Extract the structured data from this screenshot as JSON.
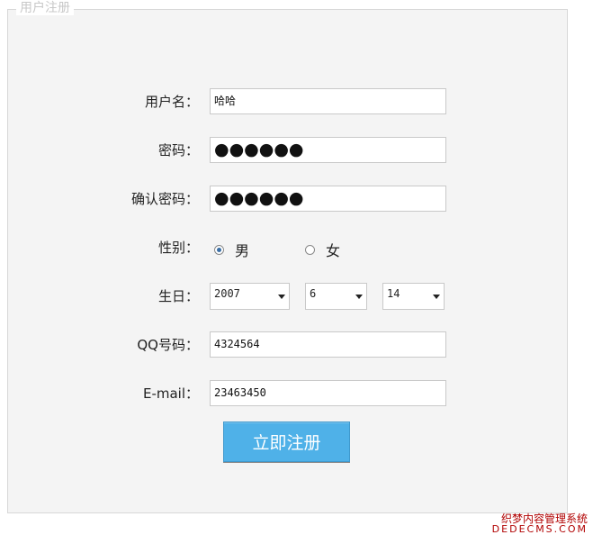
{
  "form": {
    "legend": "用户注册",
    "labels": {
      "username": "用户名：",
      "password": "密码：",
      "confirm": "确认密码：",
      "gender": "性别：",
      "birthday": "生日：",
      "qq": "QQ号码：",
      "email": "E-mail："
    },
    "values": {
      "username": "哈哈",
      "password": "●●●●●●",
      "confirm": "●●●●●●",
      "gender_male": "男",
      "gender_female": "女",
      "gender_selected": "男",
      "year": "2007",
      "month": "6",
      "day": "14",
      "qq": "4324564",
      "email": "23463450"
    },
    "submit_label": "立即注册"
  },
  "watermark": {
    "line1": "织梦内容管理系统",
    "line2": "DEDECMS.COM"
  }
}
